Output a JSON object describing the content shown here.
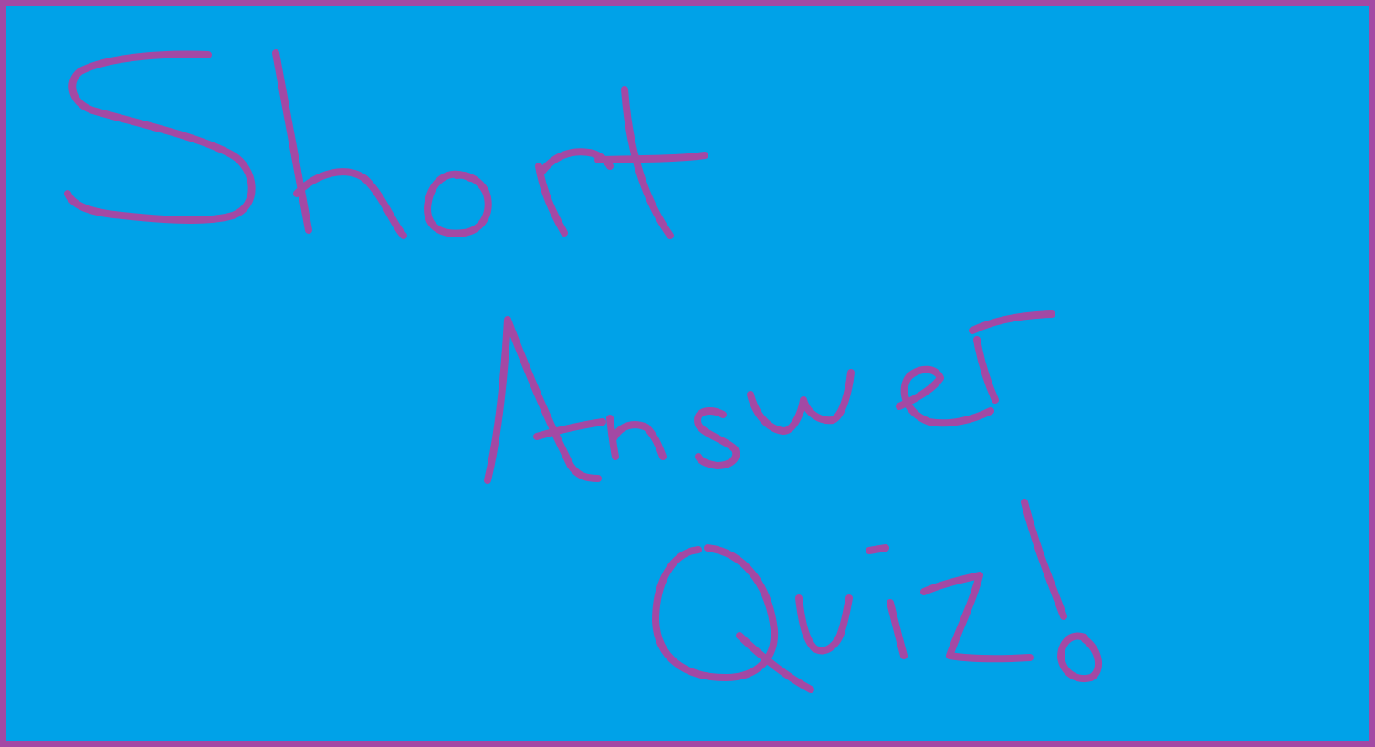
{
  "title_lines": [
    "Short",
    "Answer",
    "Quiz!"
  ],
  "colors": {
    "background": "#00a2e8",
    "ink": "#a349a4",
    "border": "#a349a4"
  }
}
